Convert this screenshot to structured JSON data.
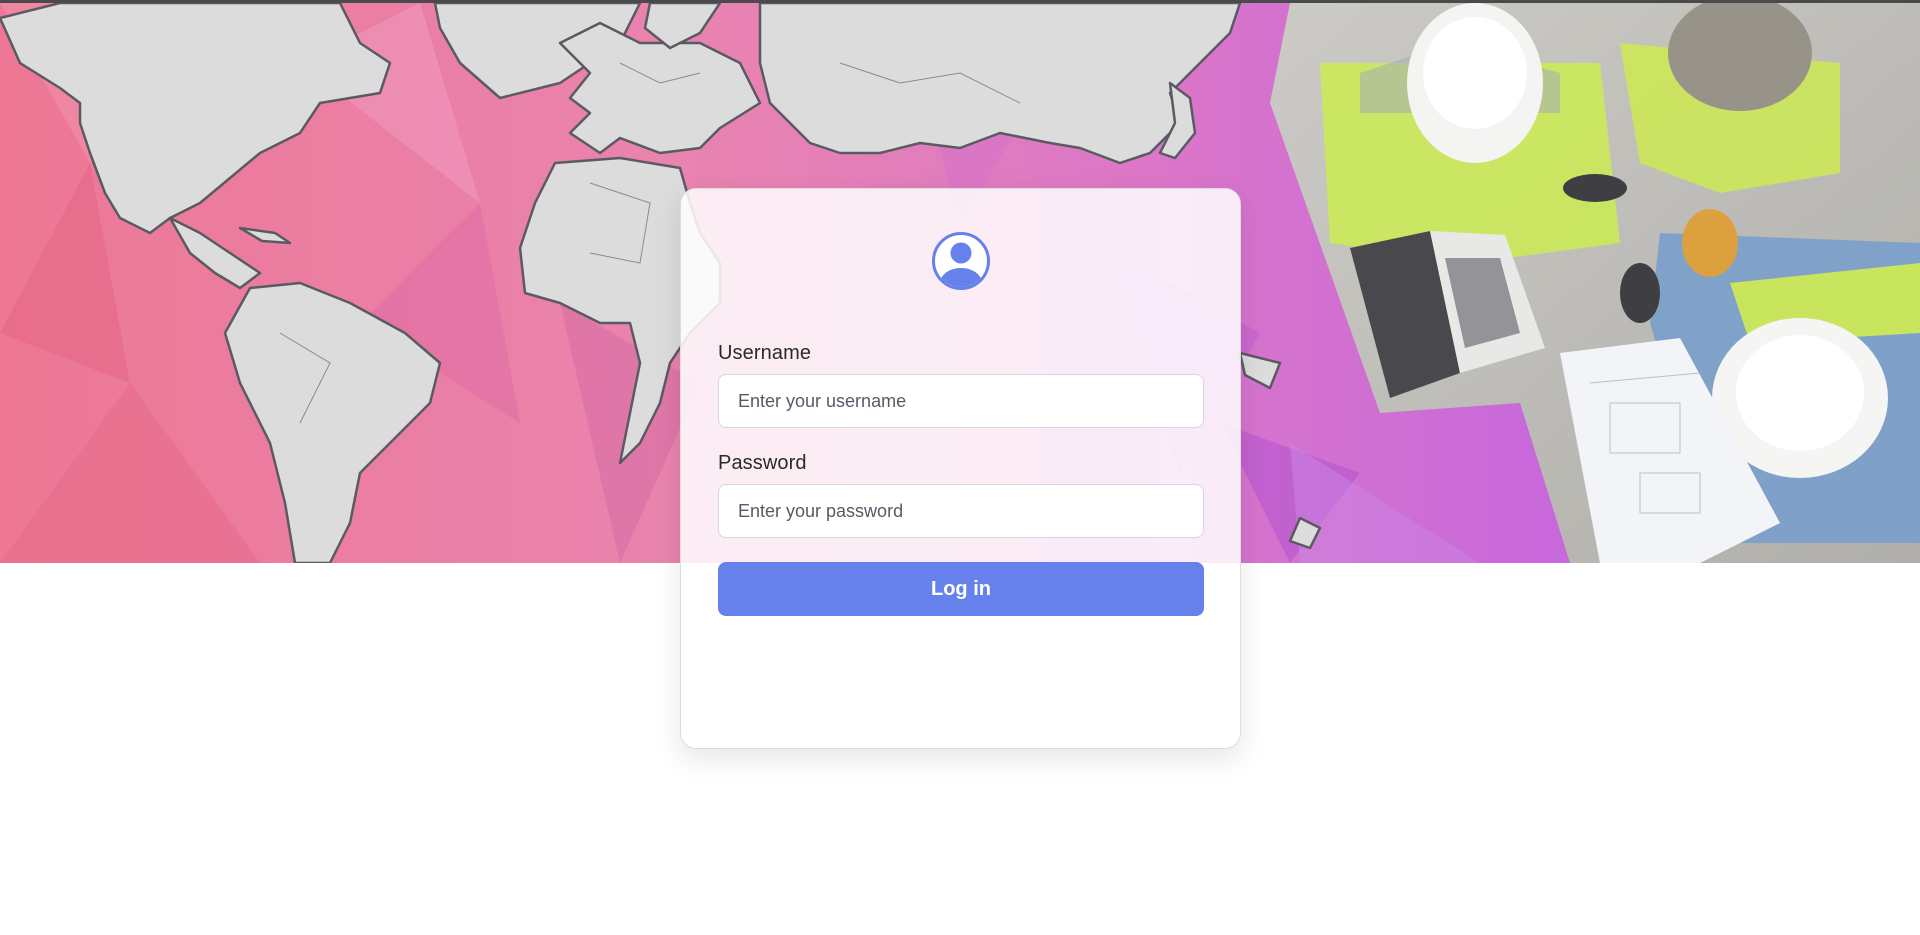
{
  "login": {
    "username_label": "Username",
    "username_placeholder": "Enter your username",
    "password_label": "Password",
    "password_placeholder": "Enter your password",
    "submit_label": "Log in"
  },
  "icons": {
    "avatar": "user-circle-icon"
  },
  "colors": {
    "accent": "#6680ec",
    "hero_pink": "#e8628c",
    "hero_magenta": "#d25ac0",
    "hero_purple": "#b84fd8",
    "map_land": "#d9d9db"
  }
}
